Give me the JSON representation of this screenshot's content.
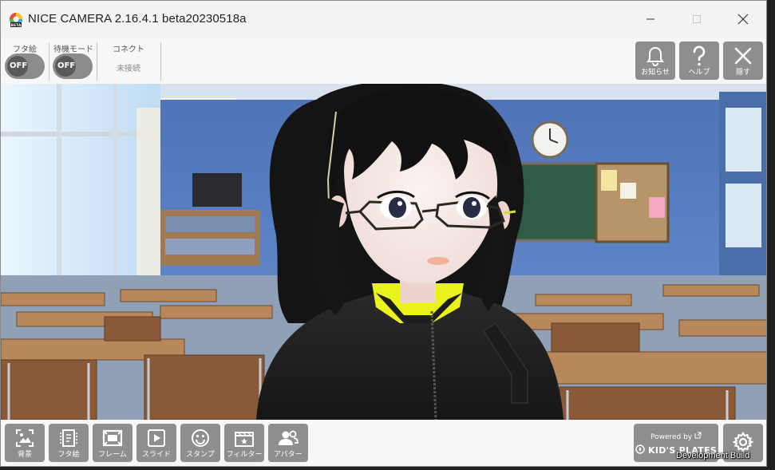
{
  "window": {
    "title": "NICE CAMERA 2.16.4.1 beta20230518a",
    "logo_badge": "BETA",
    "controls": [
      "minimize-icon",
      "maximize-icon",
      "close-icon"
    ]
  },
  "top_toolbar": {
    "lid_picture": {
      "label": "フタ絵",
      "toggle_text": "OFF",
      "state": "off"
    },
    "standby_mode": {
      "label": "待機モード",
      "toggle_text": "OFF",
      "state": "off"
    },
    "connect": {
      "label": "コネクト",
      "status": "未接続"
    },
    "buttons": [
      {
        "id": "notifications",
        "label": "お知らせ",
        "icon": "bell-icon"
      },
      {
        "id": "help",
        "label": "ヘルプ",
        "icon": "question-icon"
      },
      {
        "id": "hide",
        "label": "隠す",
        "icon": "close-icon"
      }
    ]
  },
  "bottom_toolbar": {
    "buttons": [
      {
        "id": "background",
        "label": "背景",
        "icon": "image-icon"
      },
      {
        "id": "lid-picture",
        "label": "フタ絵",
        "icon": "lid-picture-icon"
      },
      {
        "id": "frame",
        "label": "フレーム",
        "icon": "frame-icon"
      },
      {
        "id": "slide",
        "label": "スライド",
        "icon": "play-icon"
      },
      {
        "id": "stamp",
        "label": "スタンプ",
        "icon": "smiley-icon"
      },
      {
        "id": "filter",
        "label": "フィルター",
        "icon": "clapper-icon"
      },
      {
        "id": "avatar",
        "label": "アバター",
        "icon": "people-icon"
      }
    ],
    "powered_by": {
      "line1": "Powered by",
      "brand": "KID'S PLATES"
    },
    "settings_icon": "gear-icon"
  },
  "overlay": {
    "build_label": "Development Build"
  },
  "colors": {
    "button_gray": "#8e8e8e",
    "toggle_off": "#8c8c8c",
    "accent_yellow": "#e9f21a"
  }
}
